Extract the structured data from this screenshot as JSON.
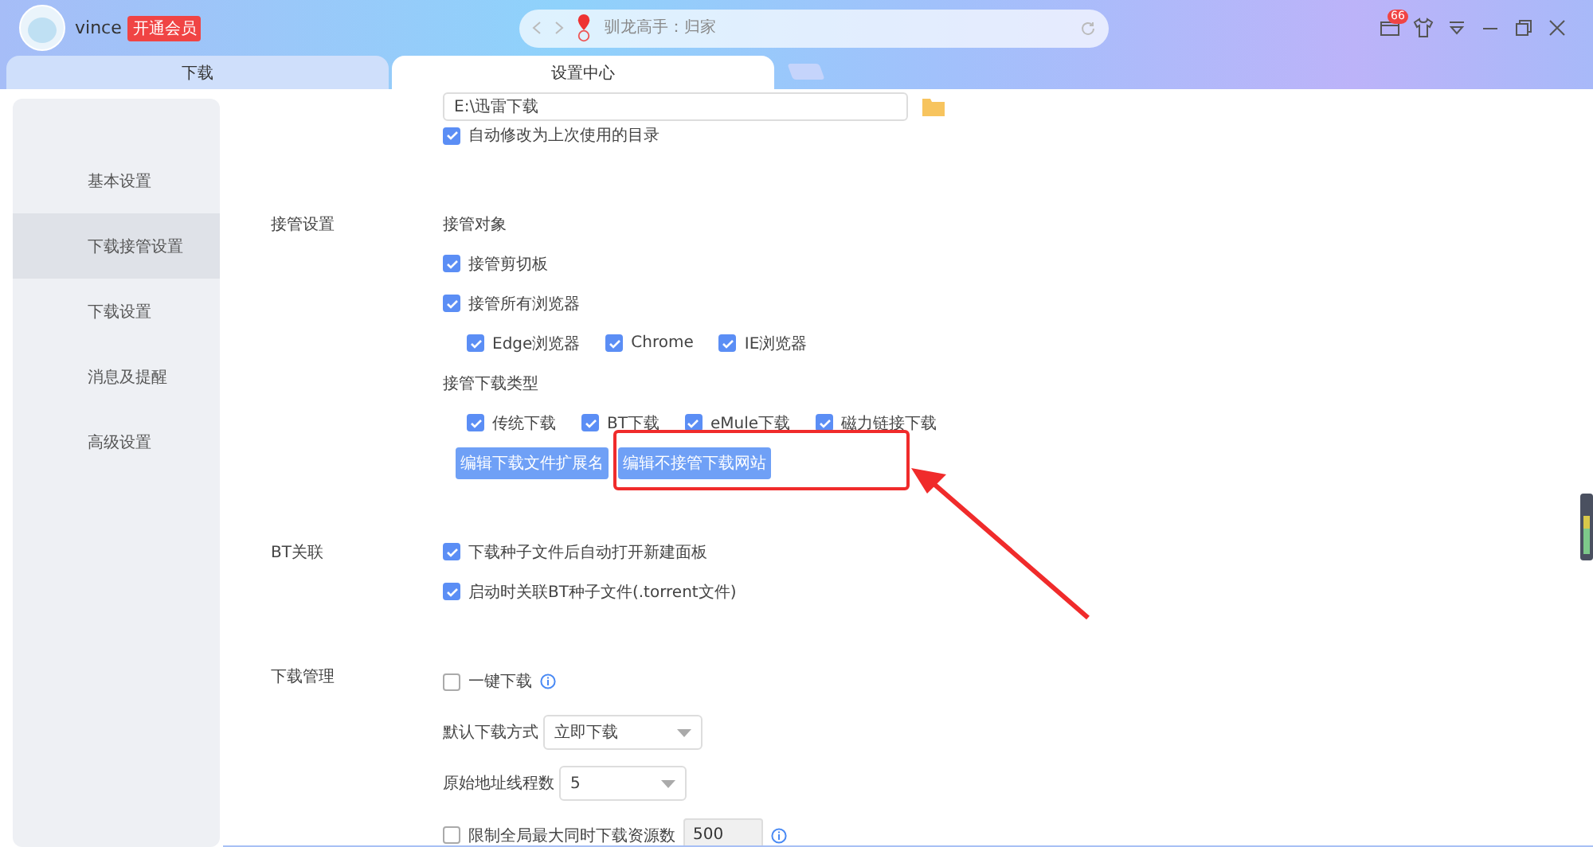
{
  "titlebar": {
    "user": "vince",
    "vip_badge": "开通会员",
    "search": {
      "placeholder": "驯龙高手：归家"
    },
    "mail_count": "66"
  },
  "tabs": [
    {
      "label": "下载",
      "selected": false
    },
    {
      "label": "设置中心",
      "selected": true
    }
  ],
  "sidebar": {
    "items": [
      {
        "label": "基本设置",
        "selected": false
      },
      {
        "label": "下载接管设置",
        "selected": true
      },
      {
        "label": "下载设置",
        "selected": false
      },
      {
        "label": "消息及提醒",
        "selected": false
      },
      {
        "label": "高级设置",
        "selected": false
      }
    ]
  },
  "sections": [
    {
      "rows": [
        {
          "kind": "path",
          "value": "E:\\迅雷下载"
        },
        {
          "kind": "checkbox",
          "label": "自动修改为上次使用的目录",
          "checked": true
        }
      ]
    },
    {
      "label": "接管设置",
      "rows": [
        {
          "kind": "heading",
          "label": "接管对象"
        },
        {
          "kind": "checkbox",
          "label": "接管剪切板",
          "checked": true
        },
        {
          "kind": "checkbox",
          "label": "接管所有浏览器",
          "checked": true
        },
        {
          "kind": "group",
          "items": [
            {
              "label": "Edge浏览器",
              "checked": true
            },
            {
              "label": "Chrome",
              "checked": true
            },
            {
              "label": "IE浏览器",
              "checked": true
            }
          ]
        },
        {
          "kind": "heading",
          "label": "接管下载类型"
        },
        {
          "kind": "group",
          "items": [
            {
              "label": "传统下载",
              "checked": true
            },
            {
              "label": "BT下载",
              "checked": true
            },
            {
              "label": "eMule下载",
              "checked": true
            },
            {
              "label": "磁力链接下载",
              "checked": true
            }
          ]
        },
        {
          "kind": "buttons",
          "items": [
            "编辑下载文件扩展名",
            "编辑不接管下载网站"
          ]
        }
      ]
    },
    {
      "label": "BT关联",
      "rows": [
        {
          "kind": "checkbox",
          "label": "下载种子文件后自动打开新建面板",
          "checked": true
        },
        {
          "kind": "checkbox",
          "label": "启动时关联BT种子文件(.torrent文件)",
          "checked": true
        }
      ]
    },
    {
      "label": "下载管理",
      "rows": [
        {
          "kind": "checkbox",
          "label": "一键下载",
          "checked": false,
          "info": true
        },
        {
          "kind": "select",
          "label": "默认下载方式",
          "value": "立即下载"
        },
        {
          "kind": "select",
          "label": "原始地址线程数",
          "value": "5"
        },
        {
          "kind": "checkbox",
          "label": "限制全局最大同时下载资源数",
          "checked": false,
          "value": "500",
          "info": true
        }
      ]
    }
  ]
}
